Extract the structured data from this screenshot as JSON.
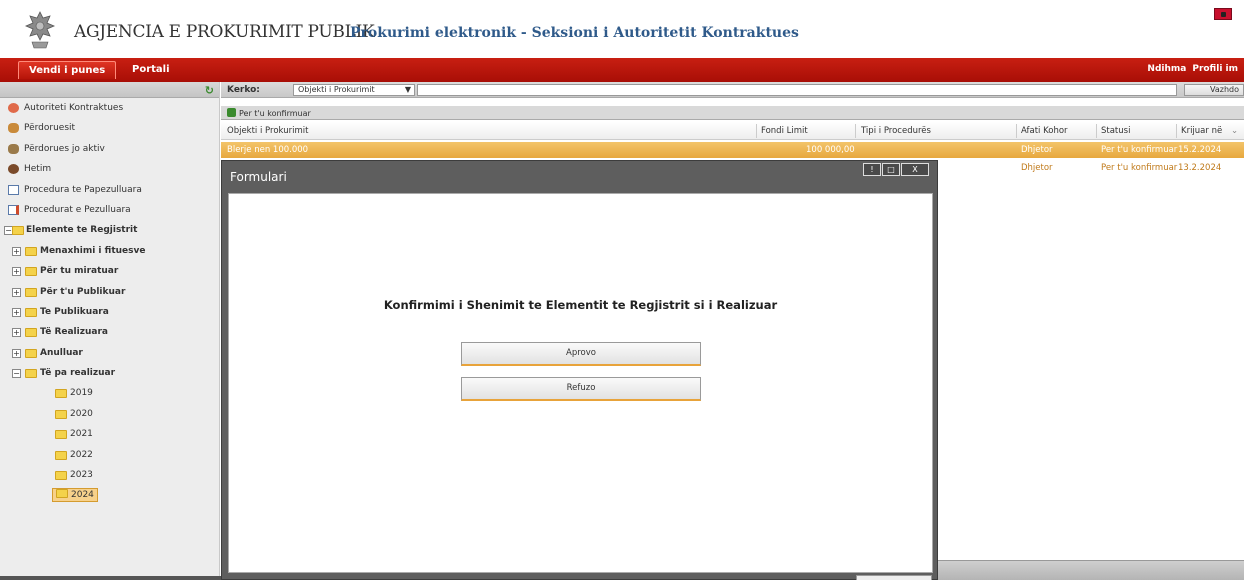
{
  "header": {
    "agency": "AGJENCIA E PROKURIMIT PUBLIK",
    "subtitle": "Prokurimi elektronik - Seksioni i Autoritetit Kontraktues"
  },
  "topnav": {
    "tabs": [
      "Vendi i punes",
      "Portali"
    ],
    "right_links": [
      "Ndihma",
      "Profili im"
    ]
  },
  "sidebar": {
    "items": [
      {
        "label": "Autoriteti Kontraktues",
        "icon": "building-icon"
      },
      {
        "label": "Përdoruesit",
        "icon": "users-icon"
      },
      {
        "label": "Përdorues jo aktiv",
        "icon": "inactive-users-icon"
      },
      {
        "label": "Hetim",
        "icon": "investigation-icon"
      },
      {
        "label": "Procedura te Papezulluara",
        "icon": "table-icon"
      },
      {
        "label": "Procedurat e Pezulluara",
        "icon": "suspended-table-icon"
      }
    ],
    "tree": {
      "root": "Elemente te Regjistrit",
      "children": [
        "Menaxhimi i fituesve",
        "Për tu miratuar",
        "Për t'u Publikuar",
        "Te Publikuara",
        "Të Realizuara",
        "Anulluar",
        "Të pa realizuar"
      ],
      "years": [
        "2019",
        "2020",
        "2021",
        "2022",
        "2023",
        "2024"
      ],
      "selected_year": "2024"
    }
  },
  "search": {
    "label": "Kerko:",
    "select_value": "Objekti i Prokurimit",
    "button": "Vazhdo"
  },
  "grid": {
    "toolbar_label": "Per t'u konfirmuar",
    "columns": [
      "Objekti i Prokurimit",
      "Fondi Limit",
      "Tipi i Procedurës",
      "Afati Kohor",
      "Statusi",
      "Krijuar në"
    ],
    "rows": [
      [
        "Blerje nen 100.000",
        "100 000,00",
        "",
        "Dhjetor",
        "Per t'u konfirmuar",
        "15.2.2024"
      ],
      [
        "",
        "",
        "",
        "Dhjetor",
        "Per t'u konfirmuar",
        "13.2.2024"
      ]
    ]
  },
  "modal": {
    "title": "Formulari",
    "ctrl": [
      "!",
      "□",
      "X"
    ],
    "message": "Konfirmimi i Shenimit te Elementit te Regjistrit si i Realizuar",
    "approve": "Aprovo",
    "reject": "Refuzo"
  }
}
